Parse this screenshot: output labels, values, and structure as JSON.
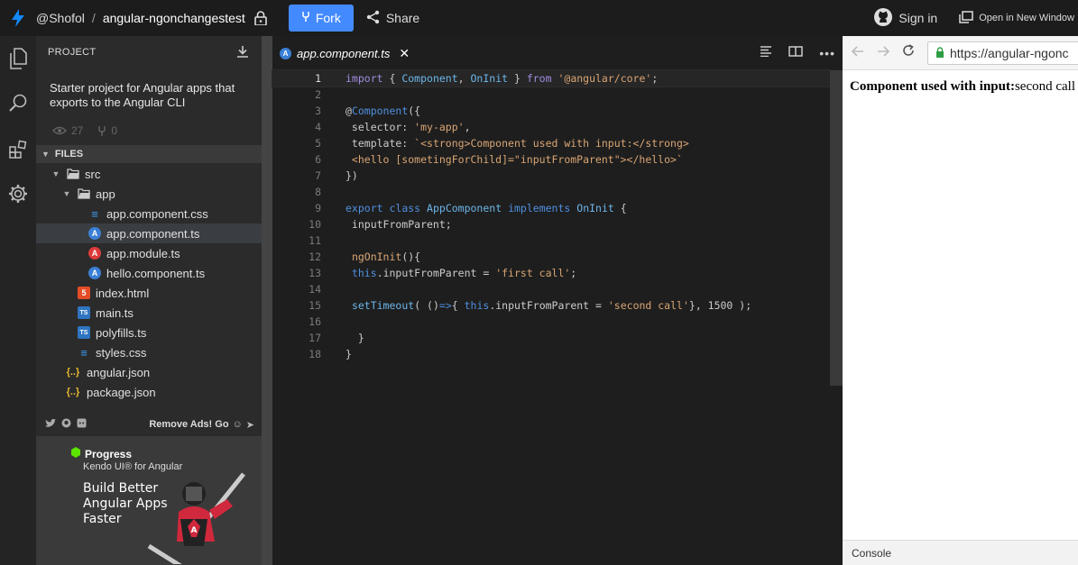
{
  "topbar": {
    "user": "@Shofol",
    "separator": "/",
    "project_name": "angular-ngonchangestest",
    "fork_label": "Fork",
    "share_label": "Share",
    "signin_label": "Sign in",
    "open_new_window_label": "Open in New Window"
  },
  "sidebar": {
    "project_header": "PROJECT",
    "description": "Starter project for Angular apps that exports to the Angular CLI",
    "views": "27",
    "forks": "0",
    "files_header": "FILES",
    "tree": [
      {
        "label": "src"
      },
      {
        "label": "app"
      },
      {
        "label": "app.component.css"
      },
      {
        "label": "app.component.ts"
      },
      {
        "label": "app.module.ts"
      },
      {
        "label": "hello.component.ts"
      },
      {
        "label": "index.html"
      },
      {
        "label": "main.ts"
      },
      {
        "label": "polyfills.ts"
      },
      {
        "label": "styles.css"
      },
      {
        "label": "angular.json"
      },
      {
        "label": "package.json"
      }
    ],
    "remove_ads": "Remove Ads! Go",
    "ad": {
      "brand": "Progress",
      "product": "Kendo UI® for Angular",
      "line1": "Build Better",
      "line2": "Angular Apps",
      "line3": "Faster"
    }
  },
  "editor": {
    "tab_label": "app.component.ts",
    "line_numbers": [
      "1",
      "2",
      "3",
      "4",
      "5",
      "6",
      "7",
      "8",
      "9",
      "10",
      "11",
      "12",
      "13",
      "14",
      "15",
      "16",
      "17",
      "18"
    ]
  },
  "preview": {
    "url": "https://angular-ngonc",
    "bold_text": "Component used with input:",
    "value_text": "second call",
    "console_label": "Console"
  },
  "colors": {
    "fork_button": "#448aff",
    "topbar_bg": "#1c1c1c",
    "editor_bg": "#1e1e1e",
    "sidebar_bg": "#2b2b2b"
  }
}
